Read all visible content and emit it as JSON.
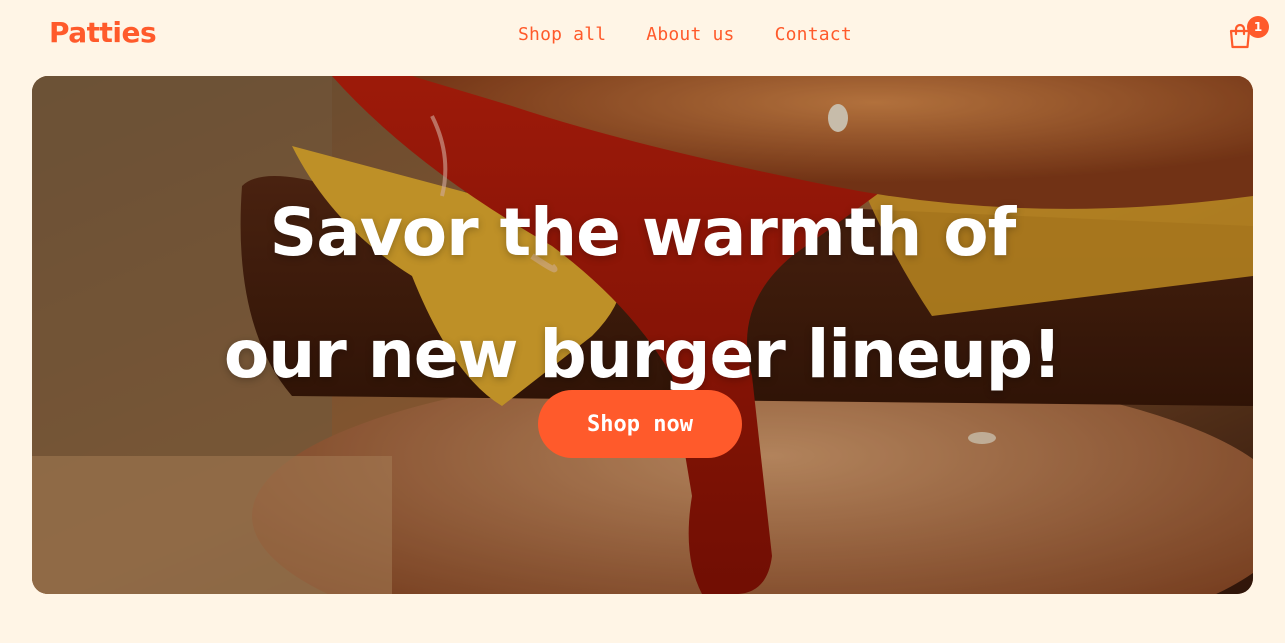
{
  "header": {
    "logo": "Patties",
    "nav": [
      {
        "label": "Shop all"
      },
      {
        "label": "About us"
      },
      {
        "label": "Contact"
      }
    ],
    "cart": {
      "icon": "shopping-bag-icon",
      "count": "1"
    }
  },
  "hero": {
    "headline_line1": "Savor the warmth of",
    "headline_line2": "our new burger lineup!",
    "cta_label": "Shop now",
    "image": "burger-photo"
  },
  "colors": {
    "brand": "#ff5a2b",
    "background": "#fff5e6",
    "text_on_hero": "#ffffff"
  }
}
